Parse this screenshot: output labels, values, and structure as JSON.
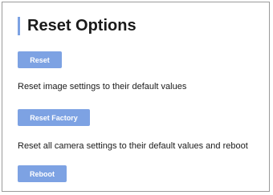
{
  "header": {
    "title": "Reset Options"
  },
  "actions": [
    {
      "button_label": "Reset",
      "description": "Reset image settings to their default values"
    },
    {
      "button_label": "Reset Factory",
      "description": "Reset all camera settings to their default values and reboot"
    },
    {
      "button_label": "Reboot"
    }
  ],
  "colors": {
    "accent": "#7da2e3",
    "text": "#1a1a1a",
    "border": "#9a9a9a"
  }
}
